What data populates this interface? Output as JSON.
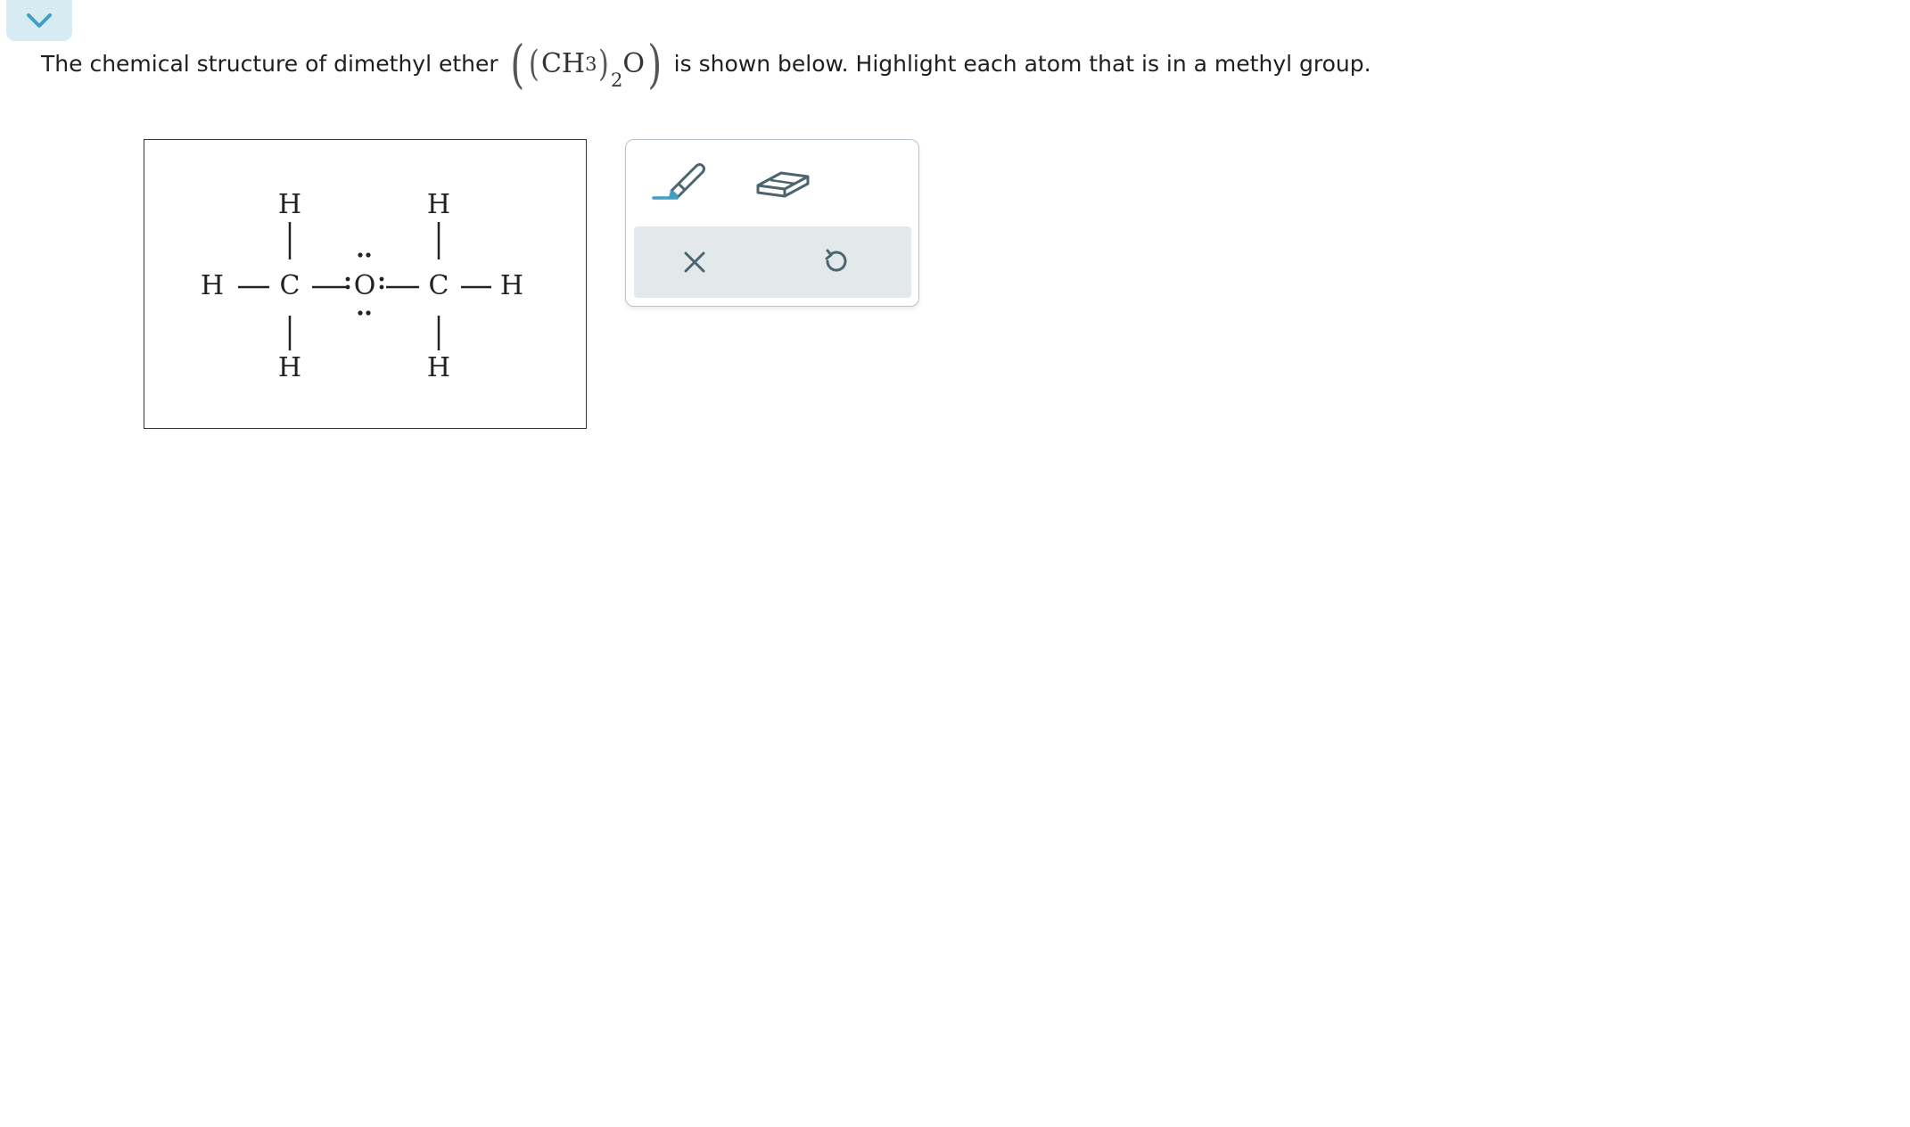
{
  "question": {
    "prefix": "The chemical structure of dimethyl ether",
    "formula": {
      "group": "CH",
      "group_sub": "3",
      "count_sub": "2",
      "atom": "O"
    },
    "suffix": "is shown below. Highlight each atom that is in a methyl group."
  },
  "molecule": {
    "atoms": {
      "h_top_left": "H",
      "h_top_right": "H",
      "h_left": "H",
      "c_left": "C",
      "o_center": "O",
      "c_right": "C",
      "h_right": "H",
      "h_bottom_left": "H",
      "h_bottom_right": "H"
    }
  },
  "toolbar": {
    "accent_color": "#3f9fc4",
    "icon_color": "#4a6470"
  }
}
